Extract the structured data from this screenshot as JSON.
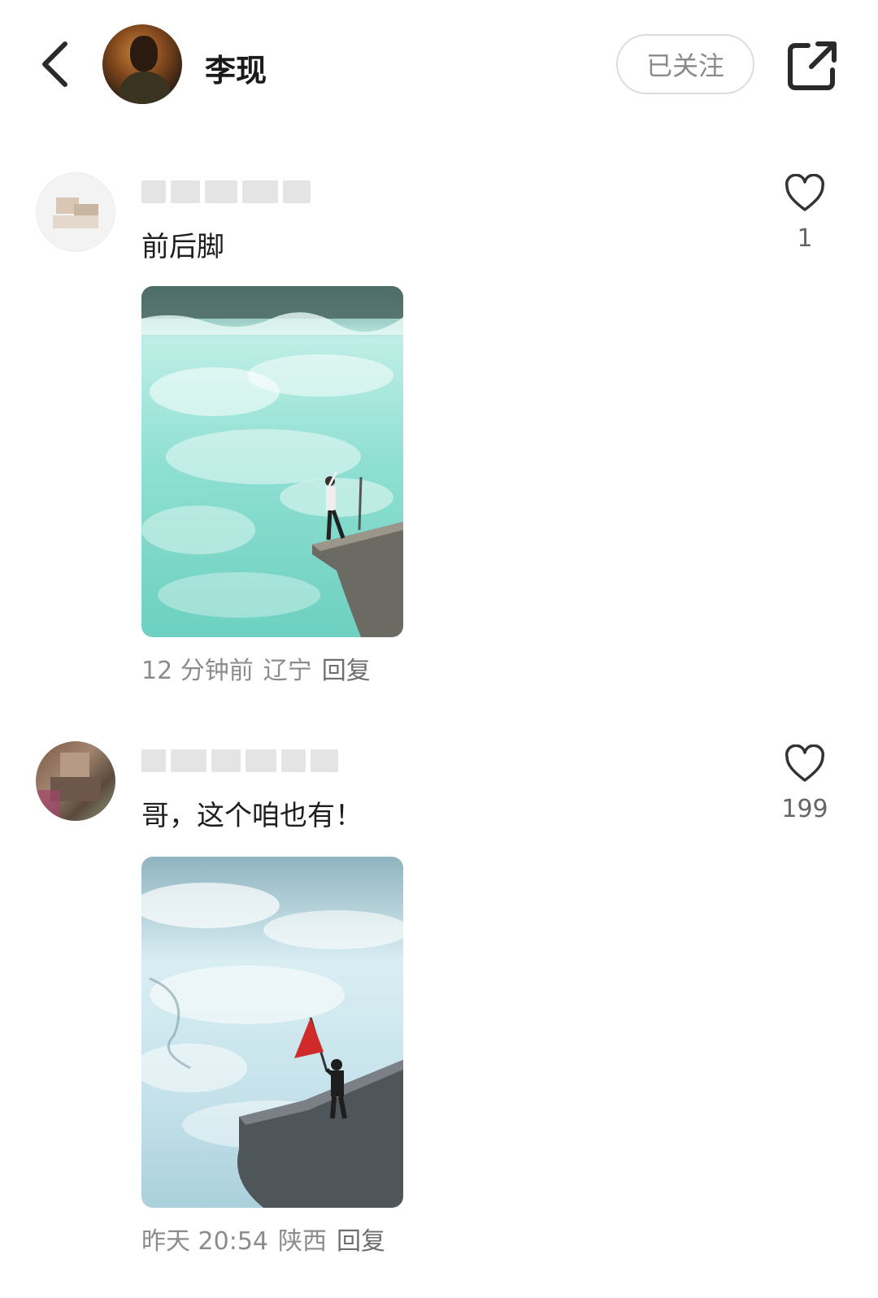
{
  "header": {
    "user_name": "李现",
    "follow_label": "已关注"
  },
  "comments": [
    {
      "text": "前后脚",
      "like_count": "1",
      "time": "12 分钟前",
      "location": "辽宁",
      "reply_label": "回复",
      "photo": "waterfall-woman-on-cliff"
    },
    {
      "text": "哥，这个咱也有！",
      "like_count": "199",
      "time": "昨天 20:54",
      "location": "陕西",
      "reply_label": "回复",
      "photo": "waterfall-person-with-red-flag"
    }
  ],
  "colors": {
    "accent_text": "#1a1a1a",
    "meta_text": "#8c8c8c",
    "water_green": "#7fd8c8",
    "flag_red": "#d02a2a"
  },
  "icons": [
    "chevron-left-icon",
    "share-icon",
    "heart-icon"
  ]
}
